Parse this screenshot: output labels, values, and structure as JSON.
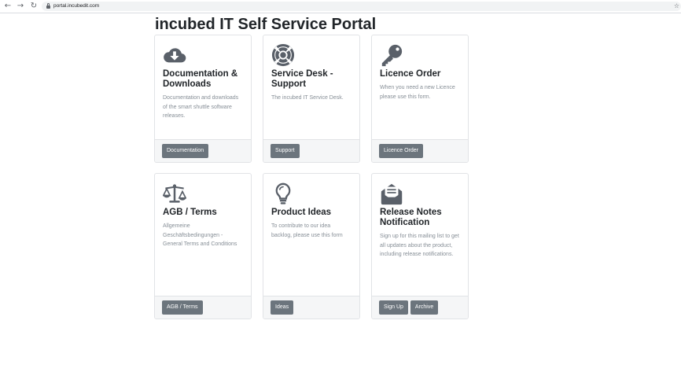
{
  "browser": {
    "back_icon": "arrow-left-icon",
    "forward_icon": "arrow-right-icon",
    "reload_icon": "reload-icon",
    "url": "portal.incubedit.com"
  },
  "page": {
    "title": "incubed IT Self Service Portal"
  },
  "colors": {
    "icon": "#5a6069",
    "button": "#6c757d",
    "footer": "#f5f6f7"
  },
  "cards": [
    {
      "icon": "cloud-download-icon",
      "title": "Documentation & Downloads",
      "text": "Documentation and downloads of the smart shuttle software releases.",
      "buttons": [
        "Documentation"
      ]
    },
    {
      "icon": "life-ring-icon",
      "title": "Service Desk - Support",
      "text": "The incubed IT Service Desk.",
      "buttons": [
        "Support"
      ]
    },
    {
      "icon": "key-icon",
      "title": "Licence Order",
      "text": "When you need a new Licence please use this form.",
      "buttons": [
        "Licence Order"
      ]
    },
    {
      "icon": "balance-scale-icon",
      "title": "AGB / Terms",
      "text": "Allgemeine Geschäftsbedingungen - General Terms and Conditions",
      "buttons": [
        "AGB / Terms"
      ]
    },
    {
      "icon": "lightbulb-icon",
      "title": "Product Ideas",
      "text": "To contribute to our idea backlog, please use this form",
      "buttons": [
        "Ideas"
      ]
    },
    {
      "icon": "envelope-open-text-icon",
      "title": "Release Notes Notification",
      "text": "Sign up for this mailing list to get all updates about the product, including release notifications.",
      "buttons": [
        "Sign Up",
        "Archive"
      ]
    }
  ]
}
